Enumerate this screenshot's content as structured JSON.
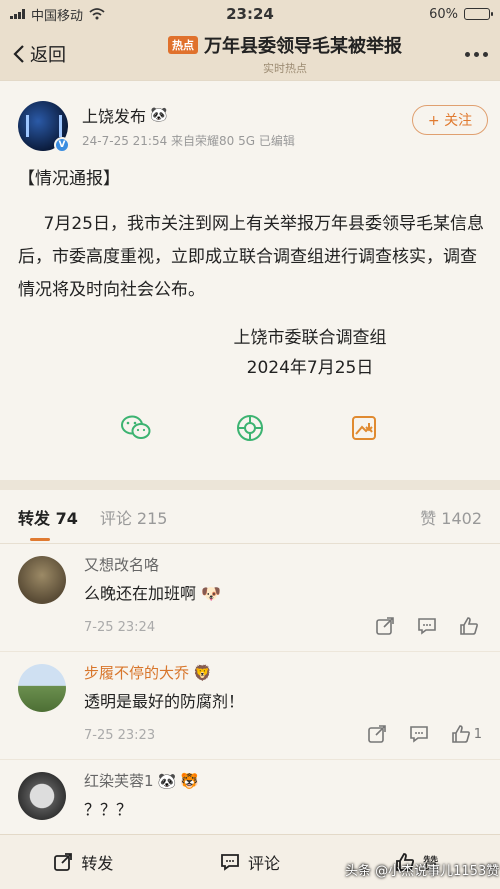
{
  "status": {
    "carrier": "中国移动",
    "time": "23:24",
    "battery": "60%",
    "battery_level": 0.6
  },
  "header": {
    "back_label": "返回",
    "hot_tag": "热点",
    "title": "万年县委领导毛某被举报",
    "subtitle": "实时热点"
  },
  "post": {
    "author": "上饶发布",
    "meta": "24-7-25 21:54  来自荣耀80 5G  已编辑",
    "follow_label": "+ 关注",
    "heading": "【情况通报】",
    "body": "7月25日，我市关注到网上有关举报万年县委领导毛某信息后，市委高度重视，立即成立联合调查组进行调查核实，调查情况将及时向社会公布。",
    "signature_org": "上饶市委联合调查组",
    "signature_date": "2024年7月25日"
  },
  "tabs": {
    "repost": "转发 74",
    "comment": "评论 215",
    "like": "赞 1402"
  },
  "comments": [
    {
      "name": "又想改名咯",
      "text": "么晚还在加班啊",
      "time": "7-25 23:24",
      "likes": ""
    },
    {
      "name": "步履不停的大乔",
      "text": "透明是最好的防腐剂！",
      "time": "7-25 23:23",
      "likes": "1"
    },
    {
      "name": "红染芙蓉1",
      "text": "？？？",
      "time": "",
      "likes": ""
    }
  ],
  "bottom": {
    "repost": "转发",
    "comment": "评论",
    "like": "赞"
  },
  "watermark": "头条 @小杰说事儿1153赞"
}
